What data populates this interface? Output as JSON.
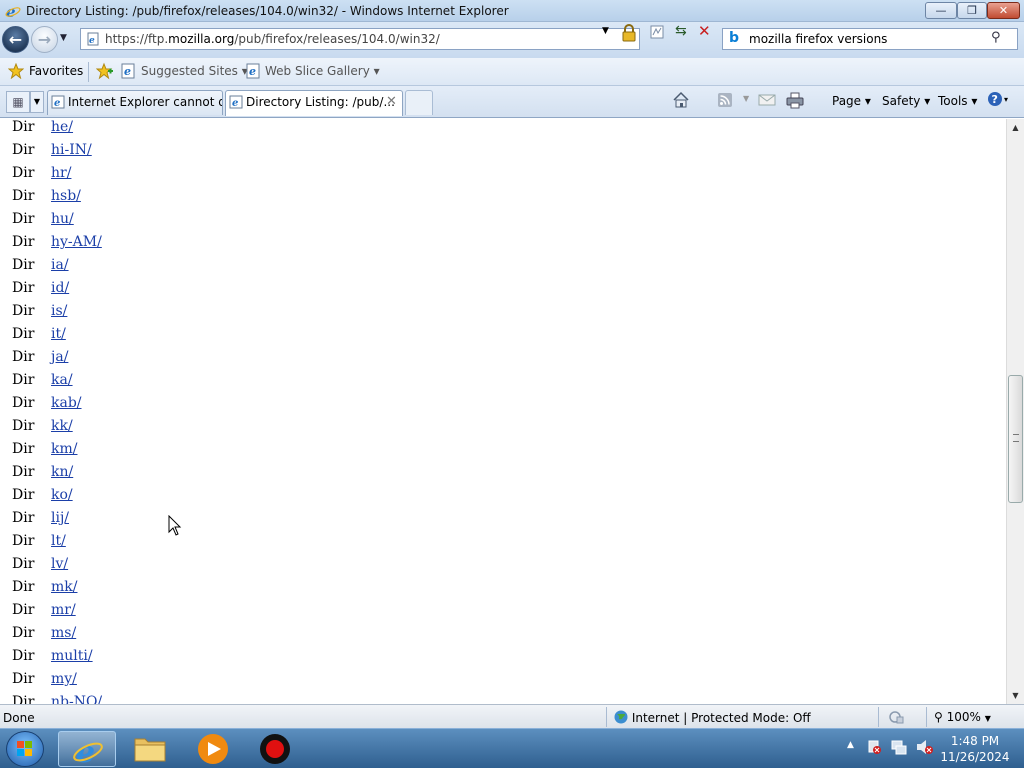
{
  "window": {
    "title": "Directory Listing: /pub/firefox/releases/104.0/win32/ - Windows Internet Explorer",
    "min_label": "—",
    "max_label": "❐",
    "close_label": "✕"
  },
  "address": {
    "prefix": "https://ftp.",
    "host": "mozilla.org",
    "path": "/pub/firefox/releases/104.0/win32/"
  },
  "search": {
    "value": "mozilla firefox versions"
  },
  "favorites": {
    "favorites_label": "Favorites",
    "suggested_label": "Suggested Sites ▾",
    "webslice_label": "Web Slice Gallery ▾"
  },
  "tabs": [
    {
      "label": "Internet Explorer cannot di..."
    },
    {
      "label": "Directory Listing: /pub/..."
    }
  ],
  "commands": {
    "page": "Page ▾",
    "safety": "Safety ▾",
    "tools": "Tools ▾",
    "help": "▾"
  },
  "listing": [
    {
      "type": "Dir",
      "name": "he/"
    },
    {
      "type": "Dir",
      "name": "hi-IN/"
    },
    {
      "type": "Dir",
      "name": "hr/"
    },
    {
      "type": "Dir",
      "name": "hsb/"
    },
    {
      "type": "Dir",
      "name": "hu/"
    },
    {
      "type": "Dir",
      "name": "hy-AM/"
    },
    {
      "type": "Dir",
      "name": "ia/"
    },
    {
      "type": "Dir",
      "name": "id/"
    },
    {
      "type": "Dir",
      "name": "is/"
    },
    {
      "type": "Dir",
      "name": "it/"
    },
    {
      "type": "Dir",
      "name": "ja/"
    },
    {
      "type": "Dir",
      "name": "ka/"
    },
    {
      "type": "Dir",
      "name": "kab/"
    },
    {
      "type": "Dir",
      "name": "kk/"
    },
    {
      "type": "Dir",
      "name": "km/"
    },
    {
      "type": "Dir",
      "name": "kn/"
    },
    {
      "type": "Dir",
      "name": "ko/"
    },
    {
      "type": "Dir",
      "name": "lij/"
    },
    {
      "type": "Dir",
      "name": "lt/"
    },
    {
      "type": "Dir",
      "name": "lv/"
    },
    {
      "type": "Dir",
      "name": "mk/"
    },
    {
      "type": "Dir",
      "name": "mr/"
    },
    {
      "type": "Dir",
      "name": "ms/"
    },
    {
      "type": "Dir",
      "name": "multi/"
    },
    {
      "type": "Dir",
      "name": "my/"
    },
    {
      "type": "Dir",
      "name": "nb-NO/"
    }
  ],
  "status": {
    "text": "Done",
    "zone": "Internet | Protected Mode: Off",
    "zoom": "100%"
  },
  "clock": {
    "time": "1:48 PM",
    "date": "11/26/2024"
  },
  "colors": {
    "link": "#1b3fa8",
    "taskbar": "#2f5f8f"
  }
}
